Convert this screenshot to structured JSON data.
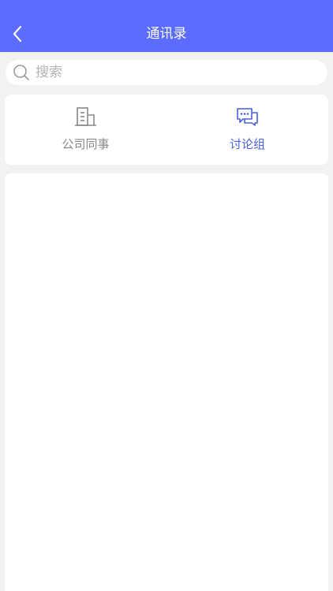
{
  "header": {
    "title": "通讯录",
    "back_icon": "chevron-left-icon"
  },
  "search": {
    "placeholder": "搜索",
    "value": "",
    "icon": "search-icon"
  },
  "tabs": [
    {
      "label": "公司同事",
      "icon": "building-icon",
      "active": false
    },
    {
      "label": "讨论组",
      "icon": "chat-bubbles-icon",
      "active": true
    }
  ],
  "colors": {
    "header_bg": "#5b6cff",
    "active_tab": "#4a5fdc",
    "inactive_tab": "#888888",
    "page_bg": "#f2f2f2"
  }
}
